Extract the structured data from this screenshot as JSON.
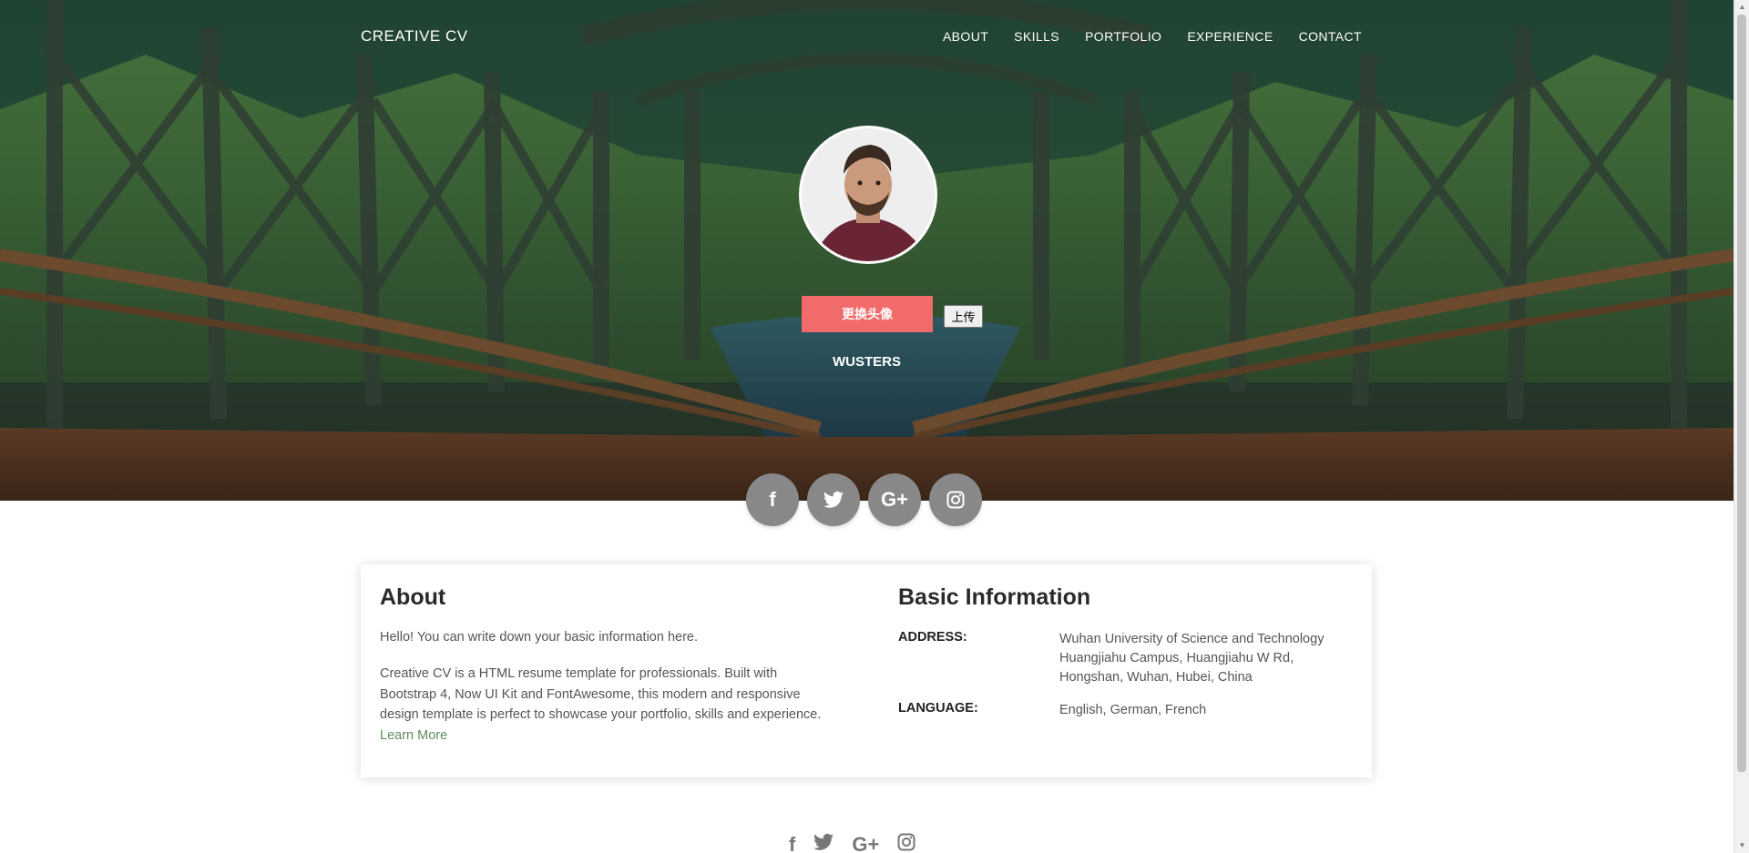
{
  "nav": {
    "brand": "CREATIVE CV",
    "links": [
      "ABOUT",
      "SKILLS",
      "PORTFOLIO",
      "EXPERIENCE",
      "CONTACT"
    ]
  },
  "hero": {
    "change_avatar_label": "更换头像",
    "upload_label": "上传",
    "name": "WUSTERS"
  },
  "social": {
    "icons": [
      "f",
      "🐦",
      "G+",
      "◎"
    ],
    "names": [
      "facebook-icon",
      "twitter-icon",
      "google-plus-icon",
      "instagram-icon"
    ]
  },
  "about": {
    "title": "About",
    "intro": "Hello! You can write down your basic information here.",
    "body": "Creative CV is a HTML resume template for professionals. Built with Bootstrap 4, Now UI Kit and FontAwesome, this modern and responsive design template is perfect to showcase your portfolio, skills and experience.",
    "learn_more": "Learn More"
  },
  "basic_info": {
    "title": "Basic Information",
    "address_label": "ADDRESS:",
    "address_value": "Wuhan University of Science and Technology Huangjiahu Campus, Huangjiahu W Rd, Hongshan, Wuhan, Hubei, China",
    "language_label": "LANGUAGE:",
    "language_value": "English, German, French"
  },
  "colors": {
    "accent": "#f26b6b",
    "link": "#5f8c5b",
    "social_circle": "#888888"
  }
}
